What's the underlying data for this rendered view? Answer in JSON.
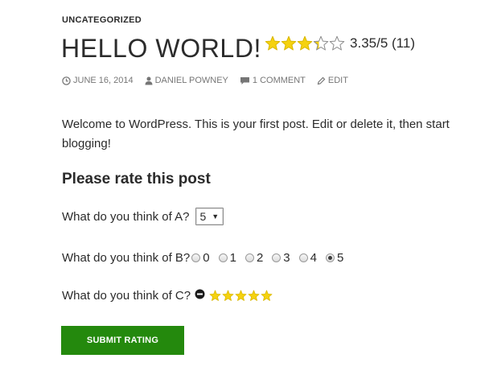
{
  "post": {
    "category": "UNCATEGORIZED",
    "title": "HELLO WORLD!",
    "rating": {
      "average": 3.35,
      "max": 5,
      "count": 11,
      "label": "3.35/5 (11)",
      "star_color": "#f5d20f",
      "icon": "star-icon"
    },
    "meta": {
      "date": "JUNE 16, 2014",
      "author": "DANIEL POWNEY",
      "comments": "1 COMMENT",
      "edit": "EDIT"
    },
    "intro": "Welcome to WordPress. This is your first post. Edit or delete it, then start blogging!"
  },
  "rating_form": {
    "heading": "Please rate this post",
    "question_a": {
      "label": "What do you think of A?",
      "selected": "5"
    },
    "question_b": {
      "label": "What do you think of B?",
      "options": [
        "0",
        "1",
        "2",
        "3",
        "4",
        "5"
      ],
      "selected": "5"
    },
    "question_c": {
      "label": "What do you think of C?",
      "stars": 5,
      "cancel_icon": "cancel-icon"
    },
    "submit_label": "SUBMIT RATING",
    "submit_color": "#24890d"
  }
}
